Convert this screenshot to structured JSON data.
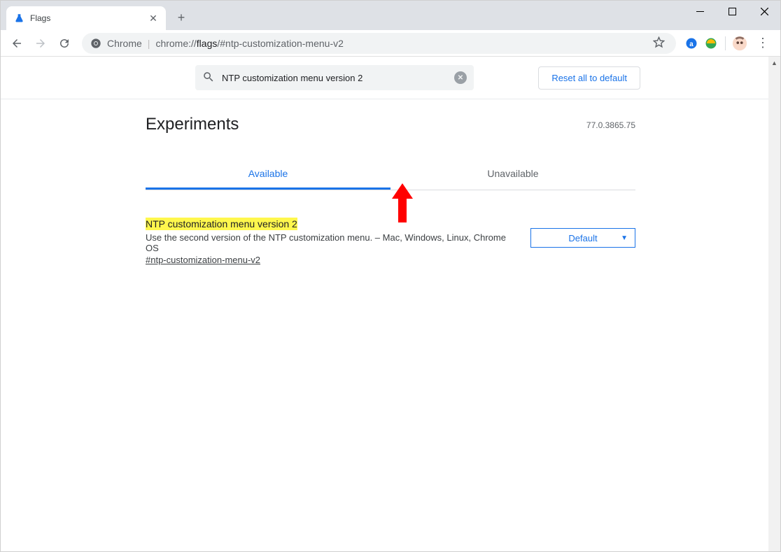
{
  "window": {
    "tab_title": "Flags"
  },
  "toolbar": {
    "chrome_label": "Chrome",
    "url_display": "chrome://flags/#ntp-customization-menu-v2",
    "url_host_part": "flags",
    "url_prefix": "chrome://",
    "url_suffix": "/#ntp-customization-menu-v2"
  },
  "flags": {
    "search_value": "NTP customization menu version 2",
    "reset_label": "Reset all to default",
    "page_title": "Experiments",
    "version": "77.0.3865.75",
    "tabs": [
      {
        "label": "Available",
        "active": true
      },
      {
        "label": "Unavailable",
        "active": false
      }
    ],
    "item": {
      "title": "NTP customization menu version 2",
      "description": "Use the second version of the NTP customization menu. – Mac, Windows, Linux, Chrome OS",
      "anchor": "#ntp-customization-menu-v2",
      "select_value": "Default"
    }
  }
}
